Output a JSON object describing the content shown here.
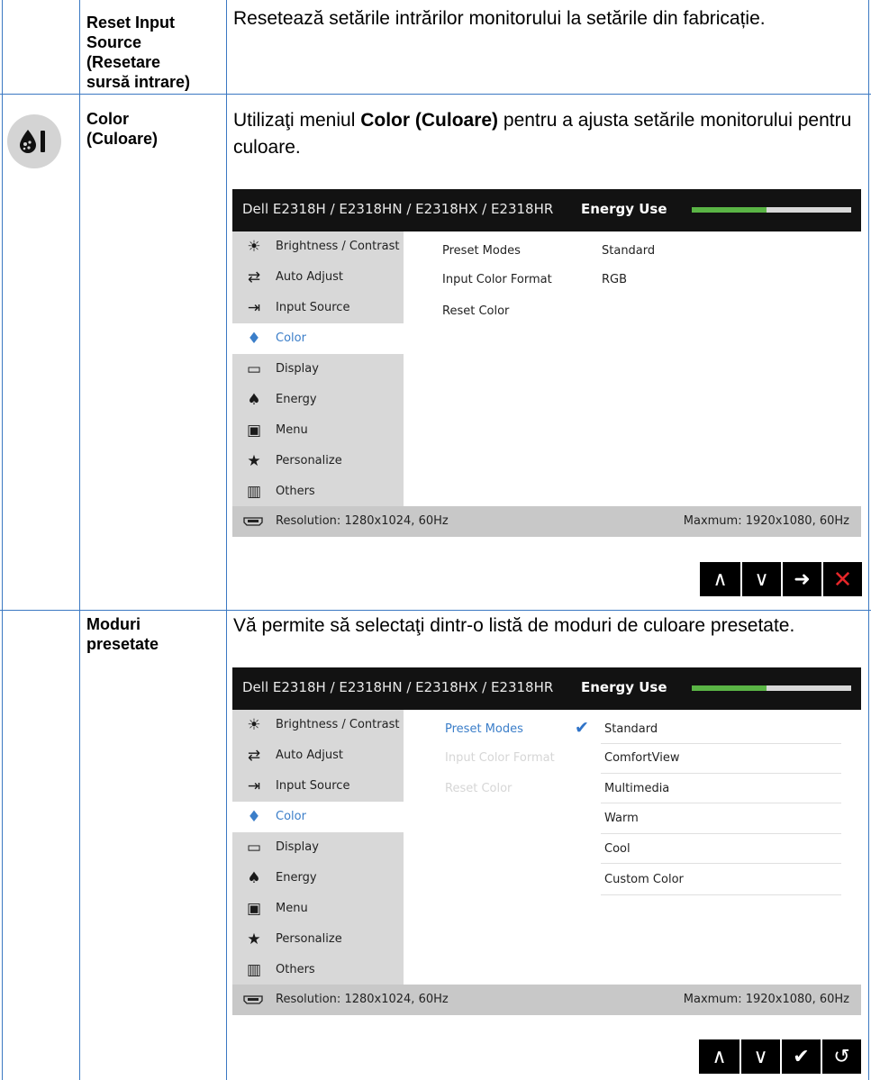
{
  "rows": [
    {
      "title": [
        "Reset Input",
        "Source",
        "(Resetare",
        "sursă intrare)"
      ],
      "description": "Resetează setările intrărilor monitorului la setările din fabricație."
    },
    {
      "title": [
        "Color",
        "(Culoare)"
      ],
      "description_parts": [
        "Utilizaţi meniul ",
        "Color (Culoare)",
        " pentru a ajusta setările monitorului pentru culoare."
      ]
    },
    {
      "title": [
        "Moduri",
        "presetate"
      ],
      "description": "Vă permite să selectaţi dintr-o listă de moduri de culoare presetate."
    }
  ],
  "osd": {
    "model": "Dell E2318H / E2318HN / E2318HX / E2318HR",
    "energy_label": "Energy Use",
    "energy_level": 0.47,
    "menu": [
      {
        "icon": "brightness-icon",
        "label": "Brightness / Contrast"
      },
      {
        "icon": "auto-adjust-icon",
        "label": "Auto Adjust"
      },
      {
        "icon": "input-source-icon",
        "label": "Input Source"
      },
      {
        "icon": "color-icon",
        "label": "Color"
      },
      {
        "icon": "display-icon",
        "label": "Display"
      },
      {
        "icon": "energy-icon",
        "label": "Energy"
      },
      {
        "icon": "menu-icon",
        "label": "Menu"
      },
      {
        "icon": "star-icon",
        "label": "Personalize"
      },
      {
        "icon": "others-icon",
        "label": "Others"
      }
    ],
    "selected_menu": "Color",
    "color_options": [
      {
        "label": "Preset Modes",
        "value": "Standard"
      },
      {
        "label": "Input Color Format",
        "value": "RGB"
      },
      {
        "label": "Reset Color",
        "value": ""
      }
    ],
    "preset_list": [
      "Standard",
      "ComfortView",
      "Multimedia",
      "Warm",
      "Cool",
      "Custom Color"
    ],
    "preset_selected": "Standard",
    "resolution": "Resolution: 1280x1024, 60Hz",
    "max_resolution": "Maxmum: 1920x1080, 60Hz",
    "accent_color": "#3b7ec9",
    "energy_bar_color": "#5ab445"
  },
  "buttons_1": [
    "up-icon",
    "down-icon",
    "arrow-right-icon",
    "close-icon"
  ],
  "buttons_2": [
    "up-icon",
    "down-icon",
    "check-icon",
    "back-icon"
  ]
}
